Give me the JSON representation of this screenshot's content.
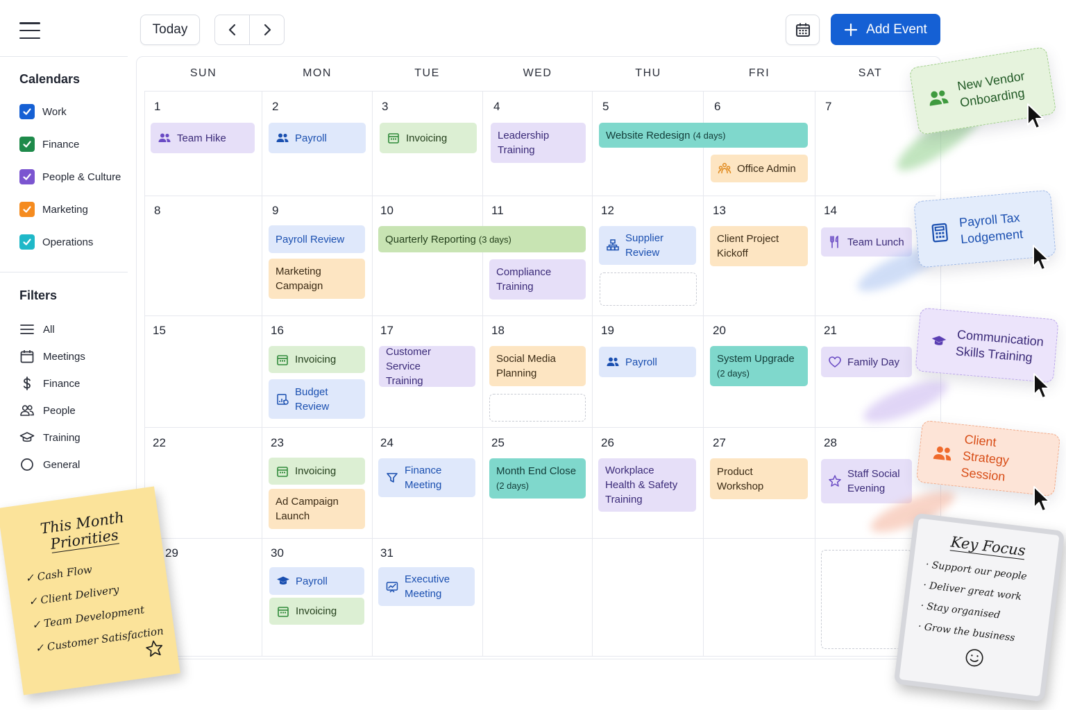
{
  "toolbar": {
    "today_label": "Today",
    "add_event_label": "Add Event",
    "accent": "#1560d4"
  },
  "sidebar": {
    "calendars_title": "Calendars",
    "calendars": [
      {
        "label": "Work",
        "color": "#1560d4",
        "checked": true
      },
      {
        "label": "Finance",
        "color": "#1e8a4a",
        "checked": true
      },
      {
        "label": "People & Culture",
        "color": "#7b55d0",
        "checked": true
      },
      {
        "label": "Marketing",
        "color": "#f58b1f",
        "checked": true
      },
      {
        "label": "Operations",
        "color": "#1fb8c8",
        "checked": true
      }
    ],
    "filters_title": "Filters",
    "filters": [
      {
        "label": "All",
        "icon": "list-icon"
      },
      {
        "label": "Meetings",
        "icon": "calendar-icon"
      },
      {
        "label": "Finance",
        "icon": "dollar-icon"
      },
      {
        "label": "People",
        "icon": "people-icon"
      },
      {
        "label": "Training",
        "icon": "graduation-cap-icon"
      },
      {
        "label": "General",
        "icon": "circle-icon"
      }
    ]
  },
  "calendar": {
    "weekdays": [
      "SUN",
      "MON",
      "TUE",
      "WED",
      "THU",
      "FRI",
      "SAT"
    ],
    "days": [
      "1",
      "2",
      "3",
      "4",
      "5",
      "6",
      "7",
      "8",
      "9",
      "10",
      "11",
      "12",
      "13",
      "14",
      "15",
      "16",
      "17",
      "18",
      "19",
      "20",
      "21",
      "22",
      "23",
      "24",
      "25",
      "26",
      "27",
      "28",
      "29",
      "30",
      "31"
    ],
    "events": {
      "team_hike": "Team Hike",
      "payroll_2": "Payroll",
      "invoicing_3": "Invoicing",
      "leadership_1": "Leadership",
      "leadership_2": "Training",
      "website_redesign": "Website Redesign",
      "website_redesign_span": "(4 days)",
      "office_admin": "Office Admin",
      "payroll_review": "Payroll Review",
      "marketing_campaign_1": "Marketing",
      "marketing_campaign_2": "Campaign",
      "quarterly_reporting": "Quarterly Reporting",
      "quarterly_reporting_span": "(3 days)",
      "compliance_1": "Compliance",
      "compliance_2": "Training",
      "supplier_1": "Supplier",
      "supplier_2": "Review",
      "client_kickoff_1": "Client Project",
      "client_kickoff_2": "Kickoff",
      "team_lunch": "Team Lunch",
      "invoicing_16": "Invoicing",
      "budget_1": "Budget",
      "budget_2": "Review",
      "customer_service_1": "Customer Service",
      "customer_service_2": "Training",
      "social_media_1": "Social Media",
      "social_media_2": "Planning",
      "payroll_19": "Payroll",
      "system_upgrade": "System Upgrade",
      "system_upgrade_span": "(2 days)",
      "family_day": "Family Day",
      "invoicing_23": "Invoicing",
      "ad_campaign_1": "Ad Campaign",
      "ad_campaign_2": "Launch",
      "finance_meeting_1": "Finance",
      "finance_meeting_2": "Meeting",
      "month_end_close": "Month End Close",
      "month_end_close_span": "(2 days)",
      "whs_1": "Workplace",
      "whs_2": "Health & Safety",
      "whs_3": "Training",
      "product_workshop_1": "Product",
      "product_workshop_2": "Workshop",
      "staff_social_1": "Staff Social",
      "staff_social_2": "Evening",
      "payroll_30": "Payroll",
      "invoicing_30": "Invoicing",
      "exec_meeting_1": "Executive",
      "exec_meeting_2": "Meeting"
    }
  },
  "floating_cards": [
    {
      "line1": "New Vendor",
      "line2": "Onboarding",
      "color": "#2f8a3a"
    },
    {
      "line1": "Payroll Tax",
      "line2": "Lodgement",
      "color": "#1a4fb0"
    },
    {
      "line1": "Communication",
      "line2": "Skills Training",
      "color": "#3a2a78"
    },
    {
      "line1": "Client Strategy",
      "line2": "Session",
      "color": "#d84d17"
    }
  ],
  "sticky_note": {
    "title_1": "This Month",
    "title_2": "Priorities",
    "items": [
      "Cash Flow",
      "Client Delivery",
      "Team Development",
      "Customer Satisfaction"
    ]
  },
  "focus_note": {
    "title": "Key Focus",
    "items": [
      "Support our people",
      "Deliver great work",
      "Stay organised",
      "Grow the business"
    ]
  }
}
